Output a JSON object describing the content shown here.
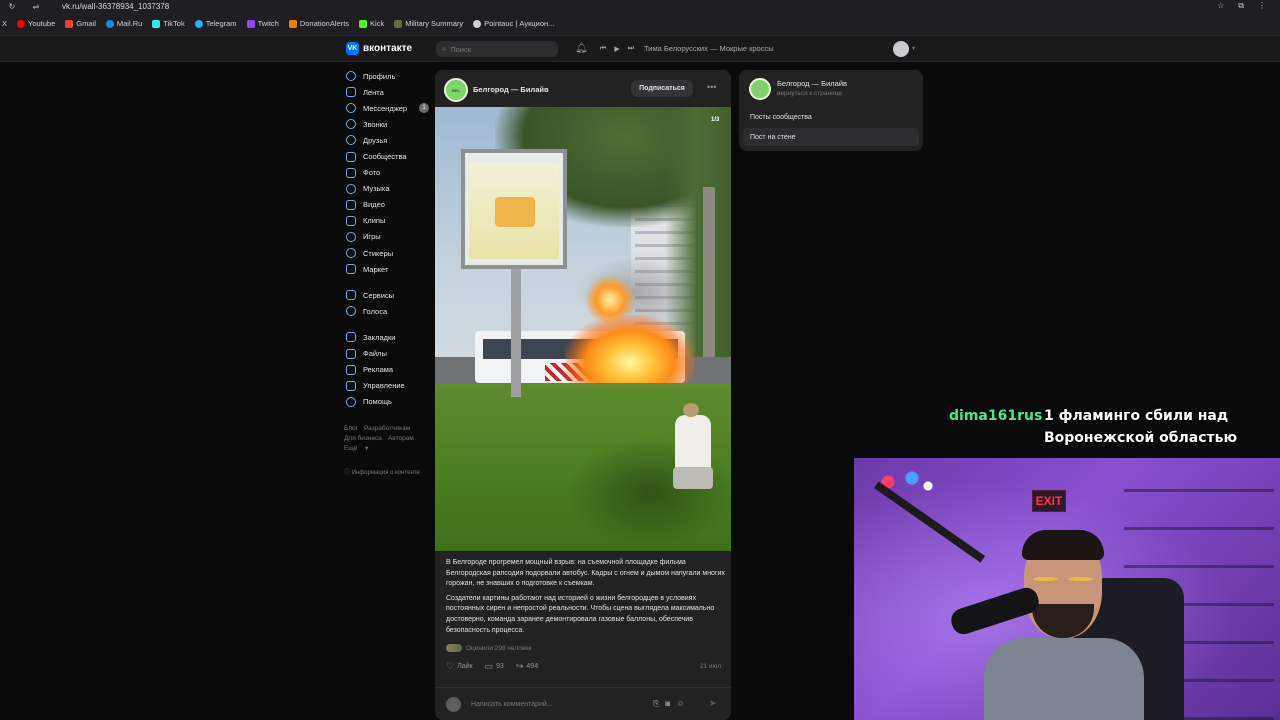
{
  "browser": {
    "url": "vk.ru/wall-36378934_1037378",
    "bookmarks": [
      {
        "label": "Youtube",
        "color": "#ff0000"
      },
      {
        "label": "Gmail",
        "color": "#ea4335"
      },
      {
        "label": "Mail.Ru",
        "color": "#168de2"
      },
      {
        "label": "TikTok",
        "color": "#25f4ee"
      },
      {
        "label": "Telegram",
        "color": "#2aabee"
      },
      {
        "label": "Twitch",
        "color": "#9146ff"
      },
      {
        "label": "DonationAlerts",
        "color": "#f57d07"
      },
      {
        "label": "Kick",
        "color": "#53fc18"
      },
      {
        "label": "Military Summary",
        "color": "#6b6b3a"
      },
      {
        "label": "Pointauc | Аукцион...",
        "color": "#d0d0d0"
      }
    ]
  },
  "header": {
    "logo": "вконтакте",
    "search_placeholder": "Поиск",
    "now_playing": "Тима Белорусских — Мокрые кроссы"
  },
  "nav": {
    "items": [
      {
        "label": "Профиль",
        "icon": "profile-icon"
      },
      {
        "label": "Лента",
        "icon": "feed-icon"
      },
      {
        "label": "Мессенджер",
        "icon": "messenger-icon",
        "badge": "1"
      },
      {
        "label": "Звонки",
        "icon": "calls-icon"
      },
      {
        "label": "Друзья",
        "icon": "friends-icon"
      },
      {
        "label": "Сообщества",
        "icon": "communities-icon"
      },
      {
        "label": "Фото",
        "icon": "photo-icon"
      },
      {
        "label": "Музыка",
        "icon": "music-icon"
      },
      {
        "label": "Видео",
        "icon": "video-icon"
      },
      {
        "label": "Клипы",
        "icon": "clips-icon"
      },
      {
        "label": "Игры",
        "icon": "games-icon"
      },
      {
        "label": "Стикеры",
        "icon": "stickers-icon"
      },
      {
        "label": "Маркет",
        "icon": "market-icon"
      }
    ],
    "items2": [
      {
        "label": "Сервисы",
        "icon": "services-icon"
      },
      {
        "label": "Голоса",
        "icon": "votes-icon"
      }
    ],
    "items3": [
      {
        "label": "Закладки",
        "icon": "bookmarks-icon"
      },
      {
        "label": "Файлы",
        "icon": "files-icon"
      },
      {
        "label": "Реклама",
        "icon": "ads-icon"
      },
      {
        "label": "Управление",
        "icon": "manage-icon"
      },
      {
        "label": "Помощь",
        "icon": "help-icon"
      }
    ],
    "footer": [
      "Блог",
      "Разработчикам",
      "Для бизнеса",
      "Авторам",
      "Ещё"
    ],
    "info": "Информация о контенте"
  },
  "post": {
    "author": "Белгород — Билайв",
    "subscribe": "Подписаться",
    "photo_counter": "1/3",
    "text_p1": "В Белгороде прогремел мощный взрыв: на съемочной площадке фильма Белгородская рапсодия подорвали автобус. Кадры с огнем и дымом напугали многих горожан, не знавших о подготовке к съемкам.",
    "text_p2": "Создатели картины работают над историей о жизни белгородцев в условиях постоянных сирен и непростой реальности. Чтобы сцена выглядела максимально достоверно, команда заранее демонтировала газовые баллоны, обеспечив безопасность процесса.",
    "rated": "Оценили 298 человек",
    "like_label": "Лайк",
    "comments": "93",
    "shares": "494",
    "date": "21 июл",
    "comment_placeholder": "Написать комментарий..."
  },
  "right_panel": {
    "name": "Белгород — Билайв",
    "back": "вернуться к странице",
    "items": [
      "Посты сообщества",
      "Пост на стене"
    ]
  },
  "stream": {
    "chat_user": "dima161rus",
    "chat_msg_line1": "1 фламинго сбили над",
    "chat_msg_line2": "Воронежской областью",
    "exit_sign": "EXIT"
  }
}
